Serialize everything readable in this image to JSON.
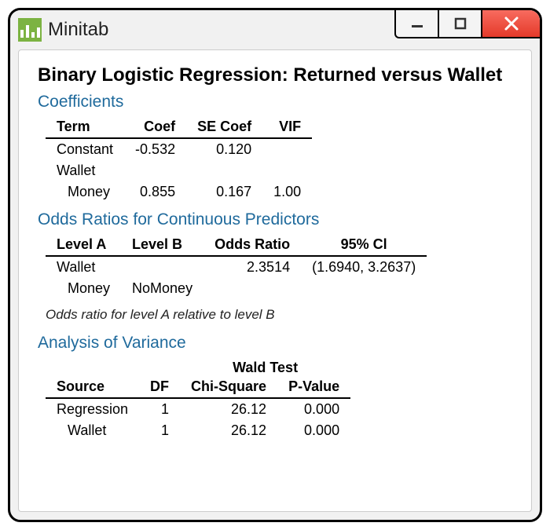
{
  "app": {
    "name": "Minitab"
  },
  "report": {
    "title": "Binary Logistic Regression: Returned versus Wallet",
    "coefficients": {
      "heading": "Coefficients",
      "headers": {
        "term": "Term",
        "coef": "Coef",
        "se": "SE Coef",
        "vif": "VIF"
      },
      "rows": [
        {
          "term": "Constant",
          "coef": "-0.532",
          "se": "0.120",
          "vif": ""
        },
        {
          "term": "Wallet",
          "coef": "",
          "se": "",
          "vif": ""
        },
        {
          "term_indent": "Money",
          "coef": "0.855",
          "se": "0.167",
          "vif": "1.00"
        }
      ]
    },
    "odds": {
      "heading": "Odds Ratios for Continuous Predictors",
      "headers": {
        "a": "Level A",
        "b": "Level B",
        "or": "Odds Ratio",
        "ci": "95% Cl"
      },
      "rows": [
        {
          "a": "Wallet",
          "b": "",
          "or": "2.3514",
          "ci": "(1.6940, 3.2637)"
        },
        {
          "a_indent": "Money",
          "b": "NoMoney",
          "or": "",
          "ci": ""
        }
      ],
      "note": "Odds ratio for level A relative to level B"
    },
    "anova": {
      "heading": "Analysis of Variance",
      "super": "Wald Test",
      "headers": {
        "source": "Source",
        "df": "DF",
        "chi": "Chi-Square",
        "p": "P-Value"
      },
      "rows": [
        {
          "source": "Regression",
          "df": "1",
          "chi": "26.12",
          "p": "0.000"
        },
        {
          "source_indent": "Wallet",
          "df": "1",
          "chi": "26.12",
          "p": "0.000"
        }
      ]
    }
  }
}
